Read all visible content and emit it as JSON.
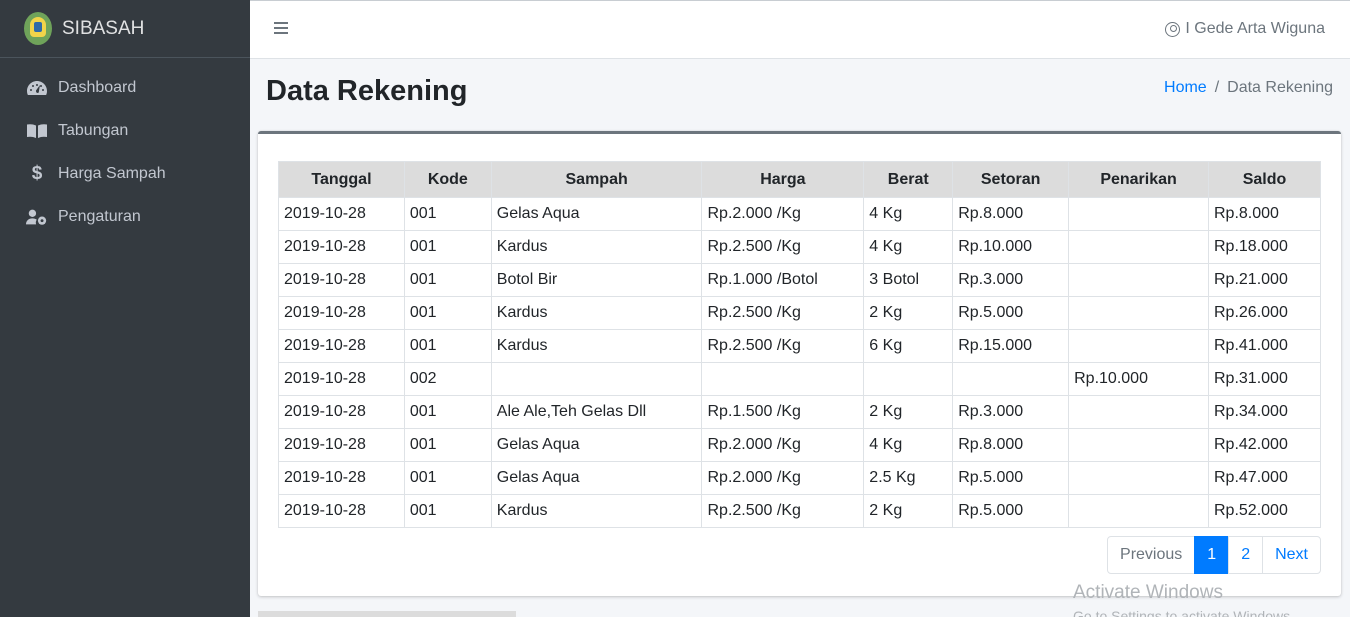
{
  "brand": {
    "name": "SIBASAH"
  },
  "sidebar": {
    "items": [
      {
        "label": "Dashboard",
        "icon": "tachometer-icon"
      },
      {
        "label": "Tabungan",
        "icon": "book-icon"
      },
      {
        "label": "Harga Sampah",
        "icon": "dollar-icon"
      },
      {
        "label": "Pengaturan",
        "icon": "users-cog-icon"
      }
    ]
  },
  "topbar": {
    "user_name": "I Gede Arta Wiguna"
  },
  "header": {
    "title": "Data Rekening",
    "breadcrumb": {
      "home": "Home",
      "current": "Data Rekening",
      "separator": "/"
    }
  },
  "table": {
    "columns": [
      "Tanggal",
      "Kode",
      "Sampah",
      "Harga",
      "Berat",
      "Setoran",
      "Penarikan",
      "Saldo"
    ],
    "rows": [
      [
        "2019-10-28",
        "001",
        "Gelas Aqua",
        "Rp.2.000 /Kg",
        "4 Kg",
        "Rp.8.000",
        "",
        "Rp.8.000"
      ],
      [
        "2019-10-28",
        "001",
        "Kardus",
        "Rp.2.500 /Kg",
        "4 Kg",
        "Rp.10.000",
        "",
        "Rp.18.000"
      ],
      [
        "2019-10-28",
        "001",
        "Botol Bir",
        "Rp.1.000 /Botol",
        "3 Botol",
        "Rp.3.000",
        "",
        "Rp.21.000"
      ],
      [
        "2019-10-28",
        "001",
        "Kardus",
        "Rp.2.500 /Kg",
        "2 Kg",
        "Rp.5.000",
        "",
        "Rp.26.000"
      ],
      [
        "2019-10-28",
        "001",
        "Kardus",
        "Rp.2.500 /Kg",
        "6 Kg",
        "Rp.15.000",
        "",
        "Rp.41.000"
      ],
      [
        "2019-10-28",
        "002",
        "",
        "",
        "",
        "",
        "Rp.10.000",
        "Rp.31.000"
      ],
      [
        "2019-10-28",
        "001",
        "Ale Ale,Teh Gelas Dll",
        "Rp.1.500 /Kg",
        "2 Kg",
        "Rp.3.000",
        "",
        "Rp.34.000"
      ],
      [
        "2019-10-28",
        "001",
        "Gelas Aqua",
        "Rp.2.000 /Kg",
        "4 Kg",
        "Rp.8.000",
        "",
        "Rp.42.000"
      ],
      [
        "2019-10-28",
        "001",
        "Gelas Aqua",
        "Rp.2.000 /Kg",
        "2.5 Kg",
        "Rp.5.000",
        "",
        "Rp.47.000"
      ],
      [
        "2019-10-28",
        "001",
        "Kardus",
        "Rp.2.500 /Kg",
        "2 Kg",
        "Rp.5.000",
        "",
        "Rp.52.000"
      ]
    ]
  },
  "pagination": {
    "previous": "Previous",
    "pages": [
      "1",
      "2"
    ],
    "active_page": "1",
    "next": "Next"
  },
  "watermark": {
    "line1": "Activate Windows",
    "line2": "Go to Settings to activate Windows."
  },
  "colors": {
    "sidebar_bg": "#343a40",
    "accent": "#007bff",
    "header_bg": "#dcdcdc"
  }
}
